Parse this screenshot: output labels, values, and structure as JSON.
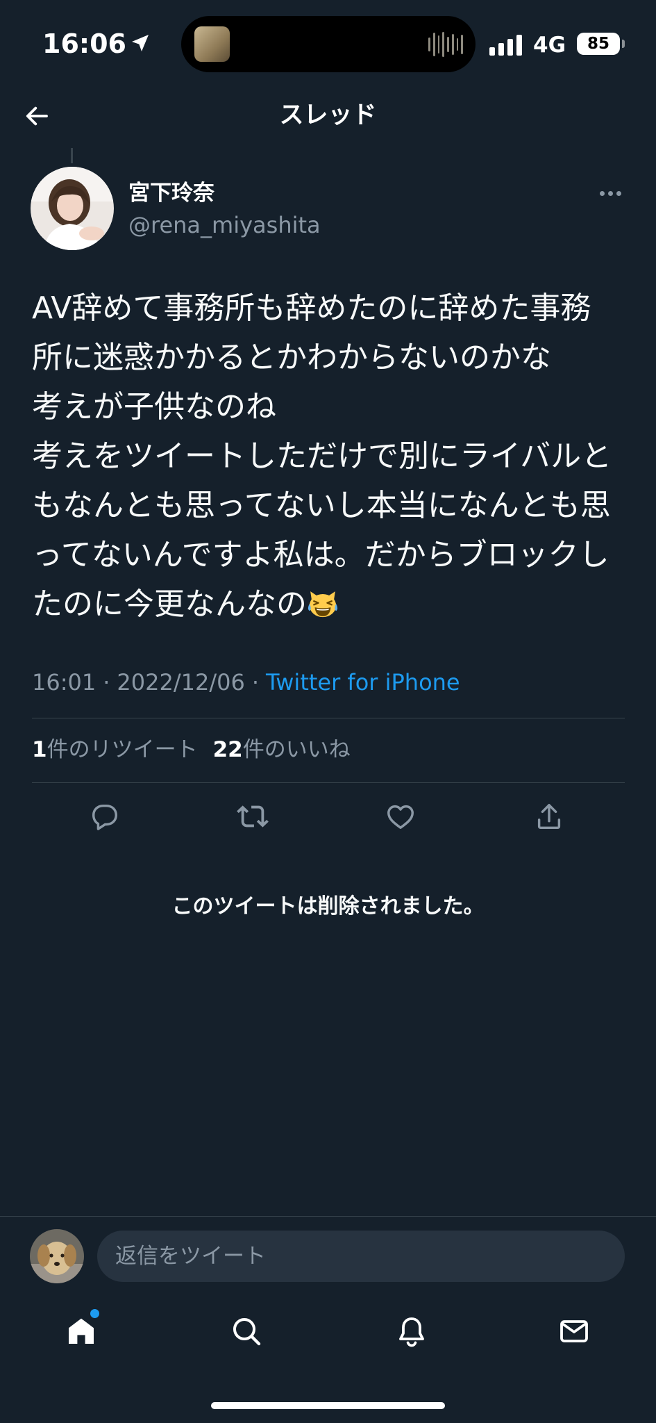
{
  "status_bar": {
    "time": "16:06",
    "network": "4G",
    "battery": "85",
    "icons": [
      "location-arrow-icon",
      "signal-bars-icon",
      "battery-icon"
    ]
  },
  "header": {
    "title": "スレッド",
    "back_icon": "arrow-left-icon"
  },
  "tweet": {
    "author_name": "宮下玲奈",
    "author_handle": "@rena_miyashita",
    "text": "AV辞めて事務所も辞めたのに辞めた事務所に迷惑かかるとかわからないのかな\n考えが子供なのね\n考えをツイートしただけで別にライバルともなんとも思ってないし本当になんとも思ってないんですよ私は。だからブロックしたのに今更なんなの",
    "trailing_emoji_icon": "cat-face-with-tears-of-joy",
    "time": "16:01",
    "separator": "·",
    "date": "2022/12/06",
    "source": "Twitter for iPhone",
    "retweet_count": "1",
    "retweet_label": "件のリツイート",
    "like_count": "22",
    "like_label": "件のいいね",
    "actions": [
      "reply-icon",
      "retweet-icon",
      "heart-icon",
      "share-icon"
    ]
  },
  "deleted_notice": "このツイートは削除されました。",
  "reply": {
    "placeholder": "返信をツイート"
  },
  "tab_bar": {
    "items": [
      "home-icon",
      "search-icon",
      "bell-icon",
      "mail-icon"
    ],
    "home_has_notification_dot": true
  },
  "colors": {
    "background": "#15202b",
    "accent": "#1d9bf0",
    "secondary_text": "#8b98a5",
    "divider": "#38444d",
    "input_background": "#273340"
  }
}
